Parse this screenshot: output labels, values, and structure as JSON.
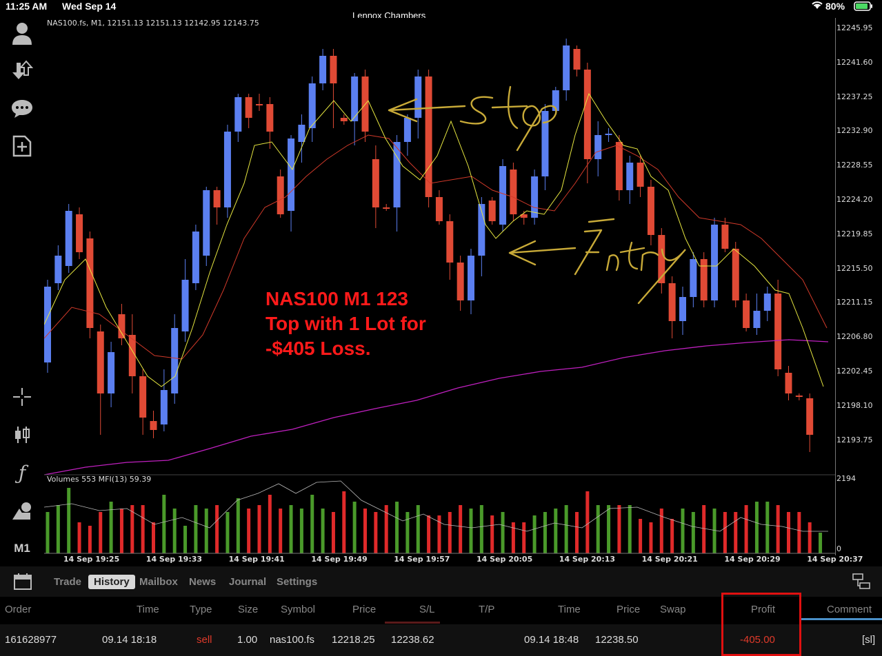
{
  "status_bar": {
    "time": "11:25 AM",
    "date": "Wed Sep 14",
    "battery": "80%"
  },
  "window_title": "Lennox Chambers",
  "chart_info": "NAS100.fs, M1, 12151.13 12151.13 12142.95 12143.75",
  "annotation_lines": [
    "NAS100 M1 123",
    "Top with 1 Lot for",
    "-$405 Loss."
  ],
  "handwriting": {
    "stop": "Stop",
    "entry": "Entry"
  },
  "volume_info": "Volumes 553 MFI(13) 59.39",
  "y_labels": [
    "12245.95",
    "12241.60",
    "12237.25",
    "12232.90",
    "12228.55",
    "12224.20",
    "12219.85",
    "12215.50",
    "12211.15",
    "12206.80",
    "12202.45",
    "12198.10",
    "12193.75"
  ],
  "volume_axis": {
    "top": "2194",
    "bottom": "0"
  },
  "x_labels": [
    "14 Sep 19:25",
    "14 Sep 19:33",
    "14 Sep 19:41",
    "14 Sep 19:49",
    "14 Sep 19:57",
    "14 Sep 20:05",
    "14 Sep 20:13",
    "14 Sep 20:21",
    "14 Sep 20:29",
    "14 Sep 20:37"
  ],
  "timeframe": "M1",
  "tabs": [
    "Trade",
    "History",
    "Mailbox",
    "News",
    "Journal",
    "Settings"
  ],
  "active_tab": "History",
  "columns": [
    "Order",
    "Time",
    "Type",
    "Size",
    "Symbol",
    "Price",
    "S/L",
    "T/P",
    "Time",
    "Price",
    "Swap",
    "Profit",
    "Comment"
  ],
  "row": {
    "order": "161628977",
    "open_time": "09.14 18:18",
    "type": "sell",
    "size": "1.00",
    "symbol": "nas100.fs",
    "open_price": "12218.25",
    "sl": "12238.62",
    "tp": "",
    "close_time": "09.14 18:48",
    "close_price": "12238.50",
    "swap": "",
    "profit": "-405.00",
    "comment": "[sl]"
  },
  "colors": {
    "bull": "#5b7ff0",
    "bear": "#e04a35",
    "vol_up": "#4a9a2a",
    "vol_down": "#e02a2a",
    "ma_fast": "#e8e840",
    "ma_slow": "#d23a2a",
    "ma_long": "#c020c0",
    "profit_loss": "#ff3a3a"
  }
}
